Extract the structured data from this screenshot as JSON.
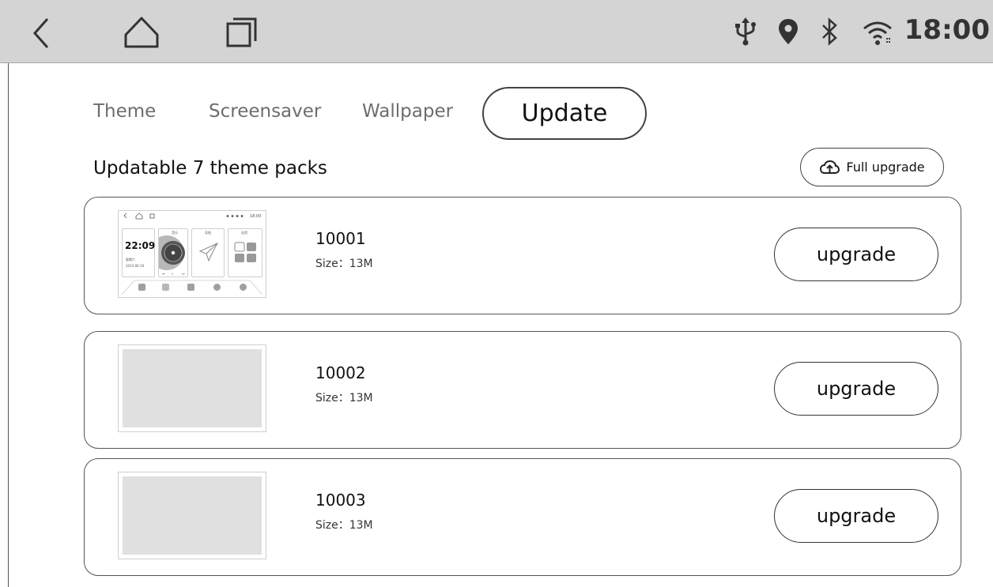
{
  "status_bar": {
    "time": "18:00",
    "nav_icons": [
      "back-icon",
      "home-icon",
      "recents-icon"
    ],
    "status_icons": [
      "usb-icon",
      "location-icon",
      "bluetooth-icon",
      "wifi-icon"
    ]
  },
  "tabs": [
    {
      "label": "Theme",
      "active": false
    },
    {
      "label": "Screensaver",
      "active": false
    },
    {
      "label": "Wallpaper",
      "active": false
    },
    {
      "label": "Update",
      "active": true
    }
  ],
  "section": {
    "title": "Updatable 7 theme packs",
    "full_upgrade_label": "Full upgrade",
    "full_upgrade_icon": "cloud-upload-icon"
  },
  "packs": [
    {
      "id": "10001",
      "size": "Size：13M",
      "button": "upgrade",
      "has_preview": true
    },
    {
      "id": "10002",
      "size": "Size：13M",
      "button": "upgrade",
      "has_preview": false
    },
    {
      "id": "10003",
      "size": "Size：13M",
      "button": "upgrade",
      "has_preview": false
    }
  ],
  "preview": {
    "clock": "22:09",
    "day": "星期六",
    "date": "2023-06-10",
    "time": "18:00",
    "panel_labels": [
      "音乐",
      "导航",
      "应用"
    ]
  },
  "colors": {
    "status_bar_bg": "#d4d4d4",
    "border": "#444444",
    "placeholder": "#e0e0e0"
  }
}
